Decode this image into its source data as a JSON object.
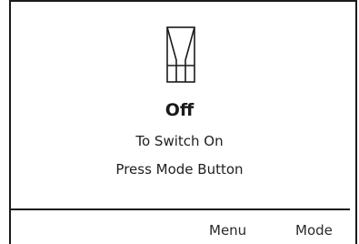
{
  "screen": {
    "status_icon": "heat-valve-icon",
    "status_title": "Off",
    "instruction_line_1": "To Switch On",
    "instruction_line_2": "Press Mode Button"
  },
  "softkeys": {
    "menu_label": "Menu",
    "mode_label": "Mode"
  },
  "colors": {
    "foreground": "#1a1a1a",
    "background": "#ffffff"
  }
}
